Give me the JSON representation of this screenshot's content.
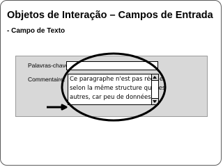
{
  "slide": {
    "title": "Objetos de Interação – Campos de Entrada",
    "subtitle": "- Campo de Texto"
  },
  "form": {
    "keywords_label": "Palavras-chave:",
    "keywords_value": "",
    "comments_label": "Commentaire:",
    "comments_value": "Ce paragraphe n'est pas rédigé\nselon la même structure que les\nautres, car peu de données"
  },
  "icons": {
    "scroll_up": "triangle-up",
    "scroll_down": "triangle-down",
    "highlight": "ellipse-outline",
    "pointer": "arrow-right"
  },
  "colors": {
    "panel_bg": "#d8d8d8",
    "highlight": "#000000"
  }
}
